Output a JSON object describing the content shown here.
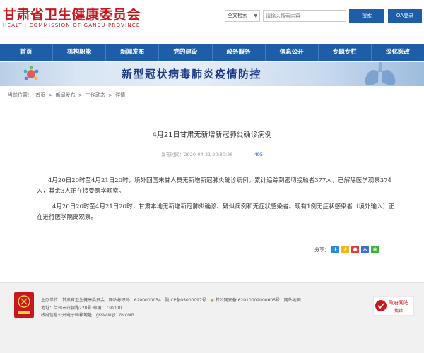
{
  "header": {
    "logo_cn": "甘肃省卫生健康委员会",
    "logo_en": "HEALTH COMMISSION OF GANSU PROVINCE",
    "search_type": "全文检索",
    "search_placeholder": "请输入搜索内容",
    "search_button": "搜索",
    "oa_button": "OA登录"
  },
  "nav": {
    "items": [
      "首页",
      "机构职能",
      "新闻发布",
      "党的建设",
      "政务服务",
      "信息公开",
      "专题专栏",
      "深化医改"
    ]
  },
  "banner": {
    "title": "新型冠状病毒肺炎疫情防控"
  },
  "breadcrumb": {
    "prefix": "当前位置：",
    "items": [
      "首页",
      "新闻发布",
      "工作动态",
      "详情"
    ],
    "separator": ">"
  },
  "article": {
    "title": "4月21日甘肃无新增新冠肺炎确诊病例",
    "meta_prefix": "发布时间：2020-04-21 20:30:26",
    "views": "405",
    "para1": "4月20日20时至4月21日20时，境外回国来甘人员无新增新冠肺炎确诊病例。累计追踪到密切接触者377人，已解除医学观察374人，其余3人正在接受医学观察。",
    "para2": "4月20日20时至4月21日20时，甘肃本地无新增新冠肺炎确诊、疑似病例和无症状感染者。现有1例无症状感染者（境外输入）正在进行医学隔离观察。",
    "share_label": "分享："
  },
  "footer": {
    "line1_a": "主办单位：甘肃省卫生健康委员会",
    "line1_b": "网站标识码：6200000054",
    "line1_c": "陇ICP备05000097号",
    "line1_d": "甘公网安备 62010002000605号",
    "line1_e": "网站地图",
    "line2": "地址：兰州市白银路220号    邮编：730000",
    "line3": "政府信息公开电子邮箱地址：gsswjw@126.com",
    "gov_badge_line1": "政府网站",
    "gov_badge_line2": "找错"
  },
  "colors": {
    "brand_red": "#c8171e",
    "nav_blue": "#1e5ea8"
  }
}
